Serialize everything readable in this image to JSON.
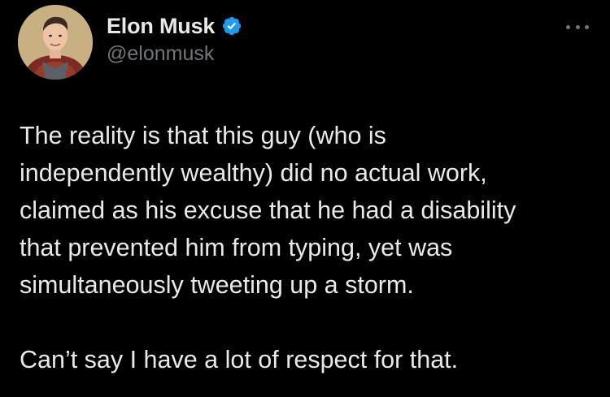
{
  "author": {
    "display_name": "Elon Musk",
    "handle": "@elonmusk",
    "verified": true,
    "verified_color": "#1d9bf0",
    "avatar_icon": "profile-photo"
  },
  "more_icon": "ellipsis-icon",
  "tweet": {
    "paragraphs": [
      "The reality is that this guy (who is\nindependently wealthy) did no actual work,\nclaimed as his excuse that he had a disability\nthat prevented him from typing, yet was\nsimultaneously tweeting up a storm.",
      "Can’t say I have a lot of respect for that."
    ]
  },
  "colors": {
    "background": "#000000",
    "text": "#e7e9ea",
    "secondary_text": "#71767b"
  }
}
